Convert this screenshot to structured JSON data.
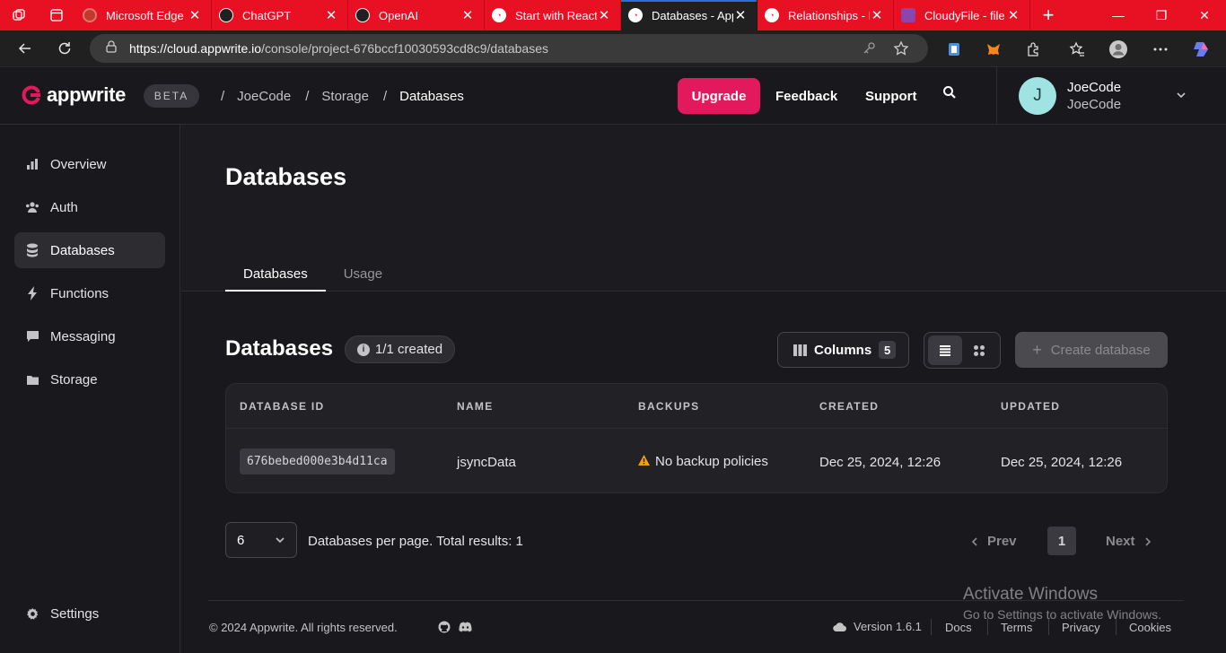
{
  "browser": {
    "tabs": [
      {
        "title": "Microsoft Edge |",
        "favicon_color": "#c0392b"
      },
      {
        "title": "ChatGPT",
        "favicon_color": "#202020"
      },
      {
        "title": "OpenAI",
        "favicon_color": "#202020"
      },
      {
        "title": "Start with React -",
        "favicon_color": "#e2195d"
      },
      {
        "title": "Databases - Appw",
        "favicon_color": "#e2195d"
      },
      {
        "title": "Relationships - D",
        "favicon_color": "#e2195d"
      },
      {
        "title": "CloudyFile - file u",
        "favicon_color": "#8e44ad"
      }
    ],
    "active_tab_index": 4,
    "url_host": "https://cloud.appwrite.io",
    "url_path": "/console/project-676bccf10030593cd8c9/databases"
  },
  "header": {
    "logo_text": "appwrite",
    "beta_label": "BETA",
    "breadcrumbs": [
      "JoeCode",
      "Storage",
      "Databases"
    ],
    "upgrade_label": "Upgrade",
    "feedback_label": "Feedback",
    "support_label": "Support",
    "user": {
      "initial": "J",
      "name": "JoeCode",
      "org": "JoeCode"
    }
  },
  "sidebar": {
    "items": [
      {
        "label": "Overview",
        "icon": "bar-chart-icon"
      },
      {
        "label": "Auth",
        "icon": "users-icon"
      },
      {
        "label": "Databases",
        "icon": "database-icon"
      },
      {
        "label": "Functions",
        "icon": "lightning-icon"
      },
      {
        "label": "Messaging",
        "icon": "chat-icon"
      },
      {
        "label": "Storage",
        "icon": "folder-icon"
      }
    ],
    "active_index": 2,
    "settings_label": "Settings"
  },
  "page": {
    "title": "Databases",
    "tabs": [
      "Databases",
      "Usage"
    ],
    "active_tab": 0,
    "section_title": "Databases",
    "created_badge": "1/1 created",
    "columns_label": "Columns",
    "columns_count": "5",
    "create_label": "Create database"
  },
  "table": {
    "headers": [
      "DATABASE ID",
      "NAME",
      "BACKUPS",
      "CREATED",
      "UPDATED"
    ],
    "rows": [
      {
        "id": "676bebed000e3b4d11ca",
        "name": "jsyncData",
        "backups": "No backup policies",
        "created": "Dec 25, 2024, 12:26",
        "updated": "Dec 25, 2024, 12:26"
      }
    ]
  },
  "pagination": {
    "per_page": "6",
    "summary": "Databases per page. Total results: 1",
    "prev_label": "Prev",
    "current_page": "1",
    "next_label": "Next"
  },
  "footer": {
    "copyright": "© 2024 Appwrite. All rights reserved.",
    "version": "Version 1.6.1",
    "links": [
      "Docs",
      "Terms",
      "Privacy",
      "Cookies"
    ]
  },
  "watermark": {
    "line1": "Activate Windows",
    "line2": "Go to Settings to activate Windows."
  },
  "colors": {
    "accent": "#e2195d",
    "background": "#19191d",
    "browser_frame": "#e81123",
    "warning": "#f59e0b"
  }
}
